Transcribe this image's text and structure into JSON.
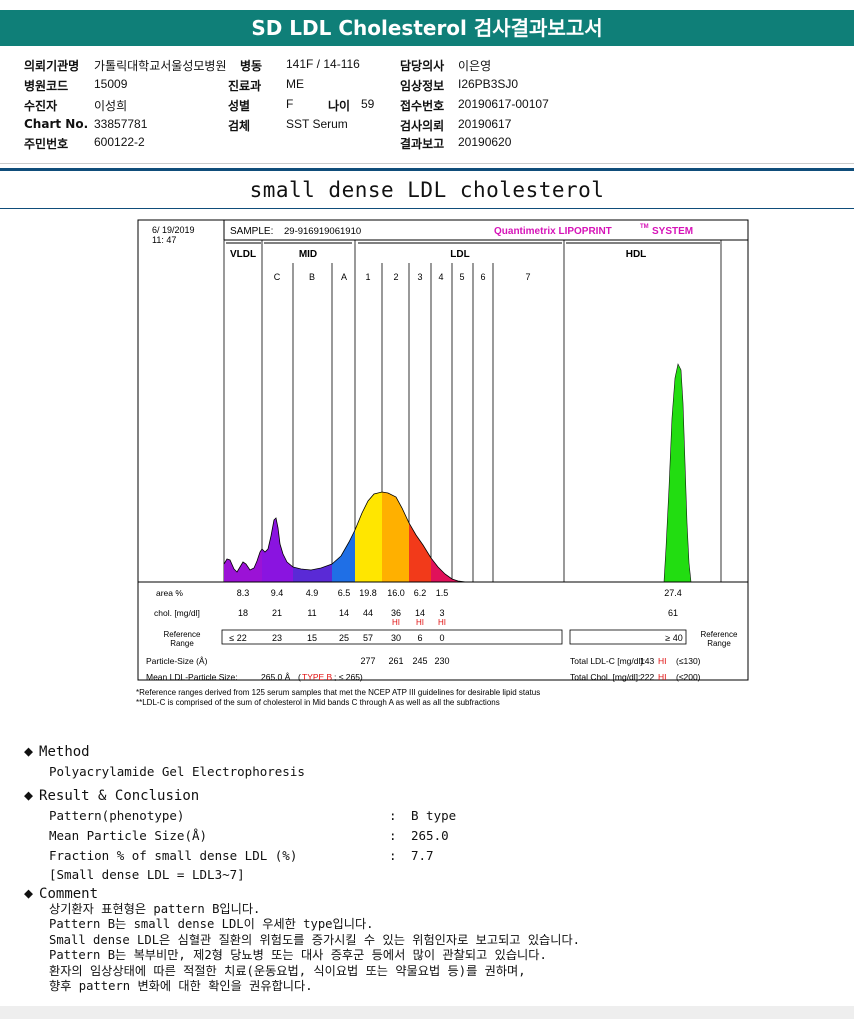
{
  "header": {
    "title": "SD LDL Cholesterol 검사결과보고서"
  },
  "patient": {
    "institution": {
      "label": "의뢰기관명",
      "value": "가톨릭대학교서울성모병원"
    },
    "ward": {
      "label": "병동",
      "value": "141F / 14-116"
    },
    "doctor": {
      "label": "담당의사",
      "value": "이은영"
    },
    "hospital_code": {
      "label": "병원코드",
      "value": "15009"
    },
    "department": {
      "label": "진료과",
      "value": "ME"
    },
    "clinical_info": {
      "label": "임상정보",
      "value": "I26PB3SJ0"
    },
    "name": {
      "label": "수진자",
      "value": "이성희"
    },
    "sex": {
      "label": "성별",
      "value": "F"
    },
    "age": {
      "label": "나이",
      "value": "59"
    },
    "receipt_no": {
      "label": "접수번호",
      "value": "20190617-00107"
    },
    "chart_no": {
      "label": "Chart No.",
      "value": "33857781"
    },
    "specimen": {
      "label": "검체",
      "value": "SST Serum"
    },
    "test_request": {
      "label": "검사의뢰",
      "value": "20190617"
    },
    "resident_no": {
      "label": "주민번호",
      "value": "600122-2"
    },
    "result_report": {
      "label": "결과보고",
      "value": "20190620"
    }
  },
  "subtitle": "small dense LDL cholesterol",
  "chart_data": {
    "type": "area",
    "date": "6/ 19/2019",
    "time": "11: 47",
    "sample_label": "SAMPLE:",
    "sample_id": "29-916919061910",
    "brand": "Quantimetrix LIPOPRINT",
    "brand_tm": "TM",
    "brand_system": "SYSTEM",
    "groups": [
      "VLDL",
      "MID",
      "LDL",
      "HDL"
    ],
    "bands": [
      "C",
      "B",
      "A",
      "1",
      "2",
      "3",
      "4",
      "5",
      "6",
      "7"
    ],
    "area_label": "area %",
    "area_values": [
      "8.3",
      "9.4",
      "4.9",
      "6.5",
      "19.8",
      "16.0",
      "6.2",
      "1.5",
      "27.4"
    ],
    "chol_label": "chol. [mg/dl]",
    "chol_values": [
      "18",
      "21",
      "11",
      "14",
      "44",
      "36",
      "14",
      "3",
      "61"
    ],
    "chol_hi": [
      "HI",
      "HI",
      "HI"
    ],
    "ref_label": "Reference Range",
    "ref_label_line1": "Reference",
    "ref_label_line2": "Range",
    "ref_values": [
      "≤ 22",
      "23",
      "15",
      "25",
      "57",
      "30",
      "6",
      "0"
    ],
    "ref_hdl": "≥ 40",
    "particle_size_label": "Particle-Size (Å)",
    "particle_sizes": [
      "277",
      "261",
      "245",
      "230"
    ],
    "total_ldl_label": "Total LDL-C [mg/dl]:",
    "total_ldl_value": "143",
    "total_ldl_flag": "HI",
    "total_ldl_ref": "(≤130)",
    "total_chol_label": "Total Chol. [mg/dl]:",
    "total_chol_value": "222",
    "total_chol_flag": "HI",
    "total_chol_ref": "(≤200)",
    "mean_size_label": "Mean LDL-Particle Size:",
    "mean_size_value": "265.0 Å",
    "mean_size_type": "TYPE B",
    "mean_size_ref": "; ≤ 265)",
    "footnote1": "*Reference ranges derived from 125 serum samples that met the NCEP ATP III guidelines for desirable lipid status",
    "footnote2": "**LDL-C is comprised of the sum of cholesterol in Mid bands C through A as well as all the subfractions",
    "band_colors": {
      "vldl": "#9b12d6",
      "C": "#8a14e0",
      "B": "#5a2ad6",
      "A": "#1f6fe6",
      "1": "#ffe600",
      "2": "#ffb000",
      "3": "#f23a1a",
      "4": "#e0115a",
      "hdl": "#22dd11"
    }
  },
  "method": {
    "heading": "Method",
    "text": "Polyacrylamide Gel Electrophoresis"
  },
  "result": {
    "heading": "Result & Conclusion",
    "rows": [
      {
        "label": "Pattern(phenotype)",
        "colon": ":",
        "value": "B type"
      },
      {
        "label": "Mean Particle Size(Å)",
        "colon": ":",
        "value": "265.0"
      },
      {
        "label": "Fraction % of small dense LDL (%)",
        "colon": ":",
        "value": "7.7"
      }
    ],
    "note": "[Small dense LDL = LDL3~7]"
  },
  "comment": {
    "heading": "Comment",
    "lines": [
      "상기환자 표현형은 pattern B입니다.",
      "Pattern B는 small dense LDL이 우세한 type입니다.",
      "Small dense LDL은 심혈관 질환의 위험도를 증가시킬 수 있는 위험인자로 보고되고 있습니다.",
      "Pattern B는 복부비만, 제2형 당뇨병 또는 대사 증후군 등에서 많이 관찰되고 있습니다.",
      "환자의 임상상태에 따른 적절한 치료(운동요법, 식이요법 또는 약물요법 등)를 권하며,",
      "향후 pattern 변화에 대한 확인을 권유합니다."
    ]
  }
}
